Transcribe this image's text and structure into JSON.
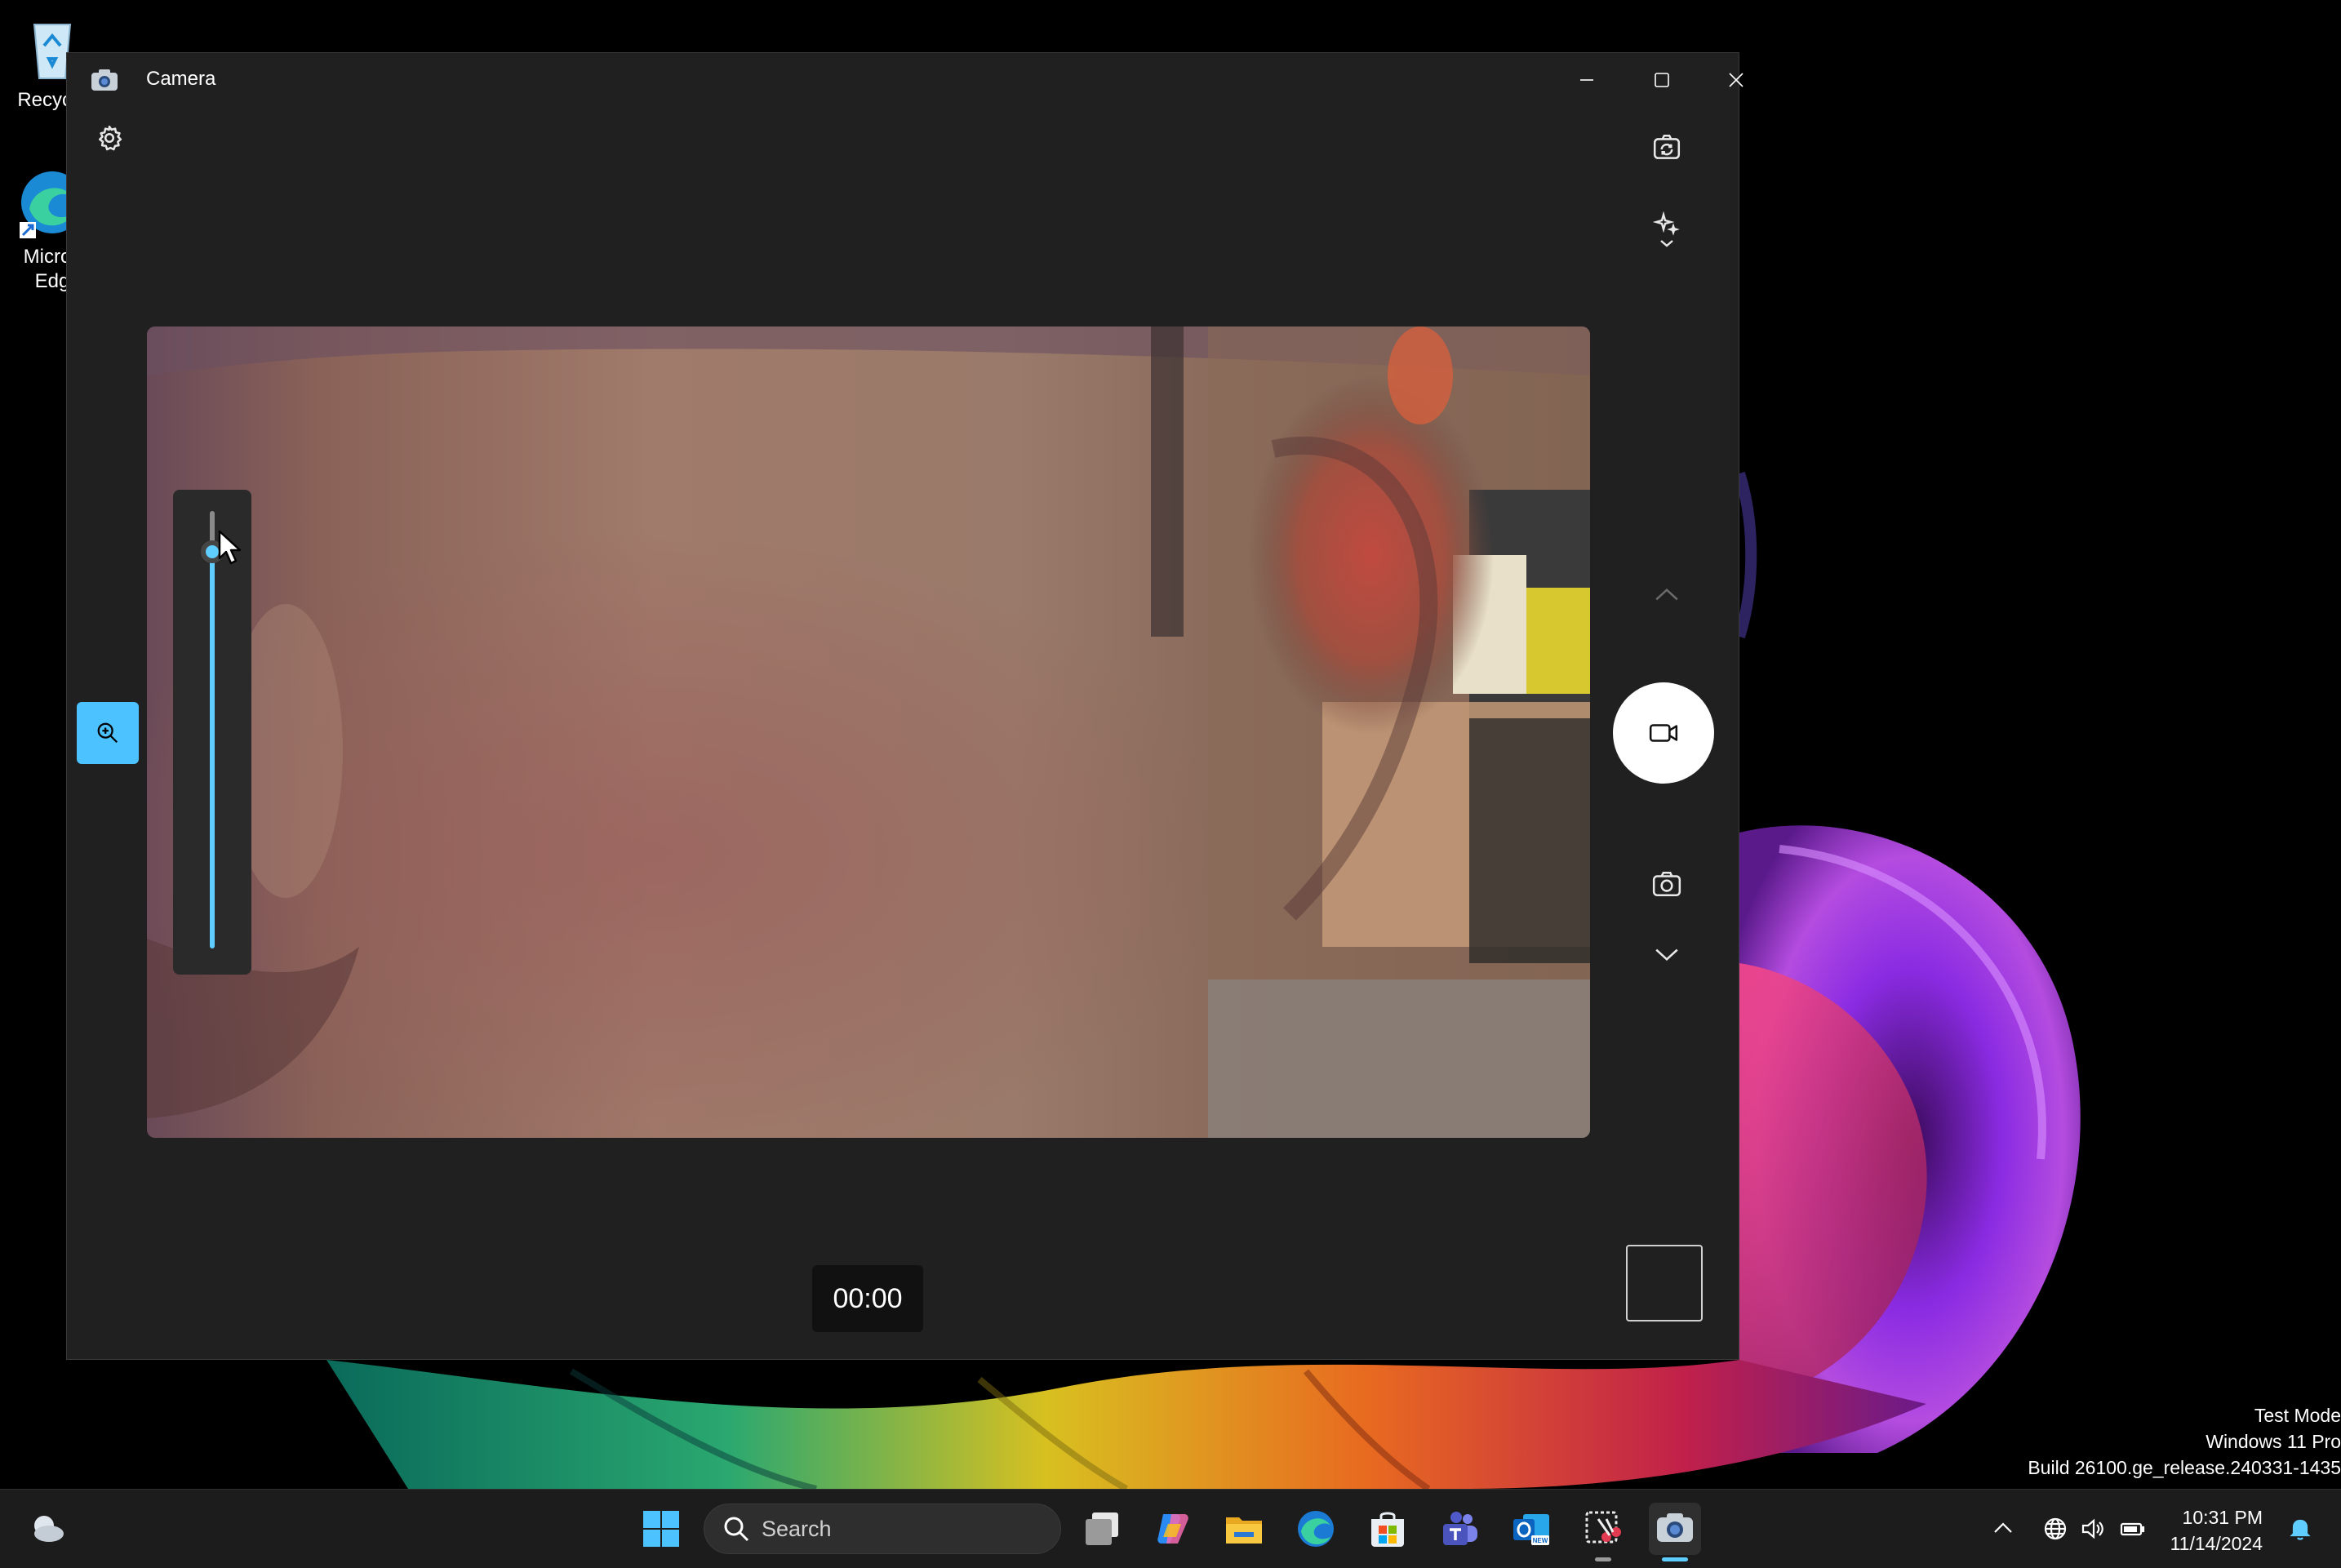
{
  "desktop": {
    "icons": [
      {
        "label": "Recycle"
      },
      {
        "label_line1": "Micros",
        "label_line2": "Edg"
      }
    ]
  },
  "window": {
    "title": "Camera",
    "minimize": "minimize",
    "maximize": "maximize",
    "close": "close"
  },
  "camera": {
    "timer": "00:00",
    "zoom_level": 0.95,
    "buttons": {
      "settings": "gear-icon",
      "switch_camera": "switch-camera-icon",
      "effects": "sparkle-icon",
      "mode_up": "chevron-up-icon",
      "record": "video-camera-icon",
      "photo": "camera-icon",
      "mode_down": "chevron-down-icon",
      "zoom": "zoom-in-icon"
    }
  },
  "watermark": {
    "line1": "Test Mode",
    "line2": "Windows 11 Pro",
    "line3": "Build 26100.ge_release.240331-1435"
  },
  "taskbar": {
    "search_placeholder": "Search",
    "time": "10:31 PM",
    "date": "11/14/2024",
    "apps": [
      "Start",
      "Task View",
      "Copilot",
      "File Explorer",
      "Microsoft Edge",
      "Microsoft Store",
      "Microsoft Teams",
      "Outlook (new)",
      "Snipping Tool",
      "Camera"
    ],
    "accent": "#60cdff"
  }
}
